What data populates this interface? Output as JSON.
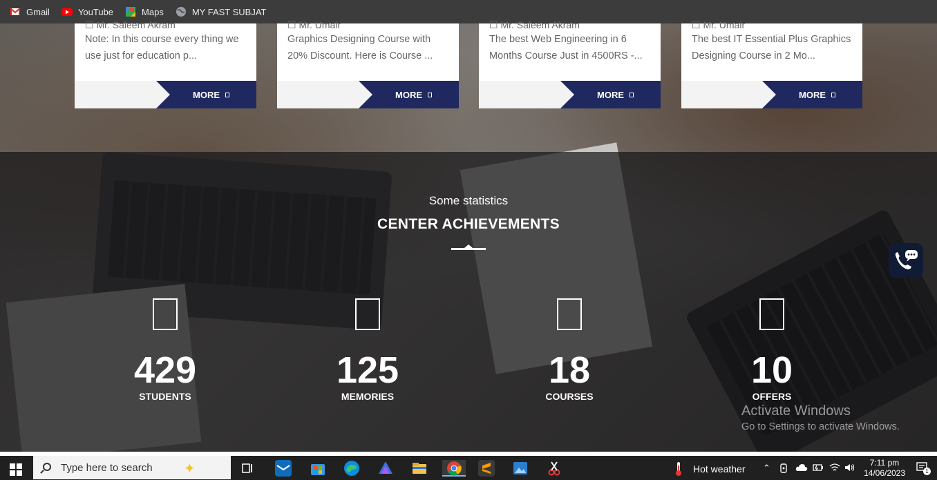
{
  "bookmarks": [
    {
      "label": "Gmail",
      "icon": "gmail-icon"
    },
    {
      "label": "YouTube",
      "icon": "youtube-icon"
    },
    {
      "label": "Maps",
      "icon": "maps-icon"
    },
    {
      "label": "MY FAST SUBJAT",
      "icon": "globe-icon"
    }
  ],
  "courses": [
    {
      "meta": "☐ Mr. Saleem Akram",
      "desc": "Note: In this course every thing we use just for education p...",
      "more": "MORE"
    },
    {
      "meta": "☐ Mr. Umair",
      "desc": "Graphics Designing Course with 20% Discount. Here is Course ...",
      "more": "MORE"
    },
    {
      "meta": "☐ Mr. Saleem Akram",
      "desc": "The best Web Engineering in 6 Months Course Just in 4500RS -...",
      "more": "MORE"
    },
    {
      "meta": "☐ Mr. Umair",
      "desc": "The best IT Essential Plus Graphics Designing Course in 2 Mo...",
      "more": "MORE"
    }
  ],
  "stats_section": {
    "subtitle": "Some statistics",
    "title": "CENTER ACHIEVEMENTS",
    "items": [
      {
        "value": "429",
        "label": "STUDENTS"
      },
      {
        "value": "125",
        "label": "MEMORIES"
      },
      {
        "value": "18",
        "label": "COURSES"
      },
      {
        "value": "10",
        "label": "OFFERS"
      }
    ]
  },
  "watermark": {
    "heading": "Activate Windows",
    "text": "Go to Settings to activate Windows."
  },
  "taskbar": {
    "search_placeholder": "Type here to search",
    "weather": "Hot weather",
    "time": "7:11 pm",
    "date": "14/06/2023",
    "notification_count": "1"
  },
  "colors": {
    "accent_navy": "#1f2960",
    "chat_button": "#101b36"
  }
}
